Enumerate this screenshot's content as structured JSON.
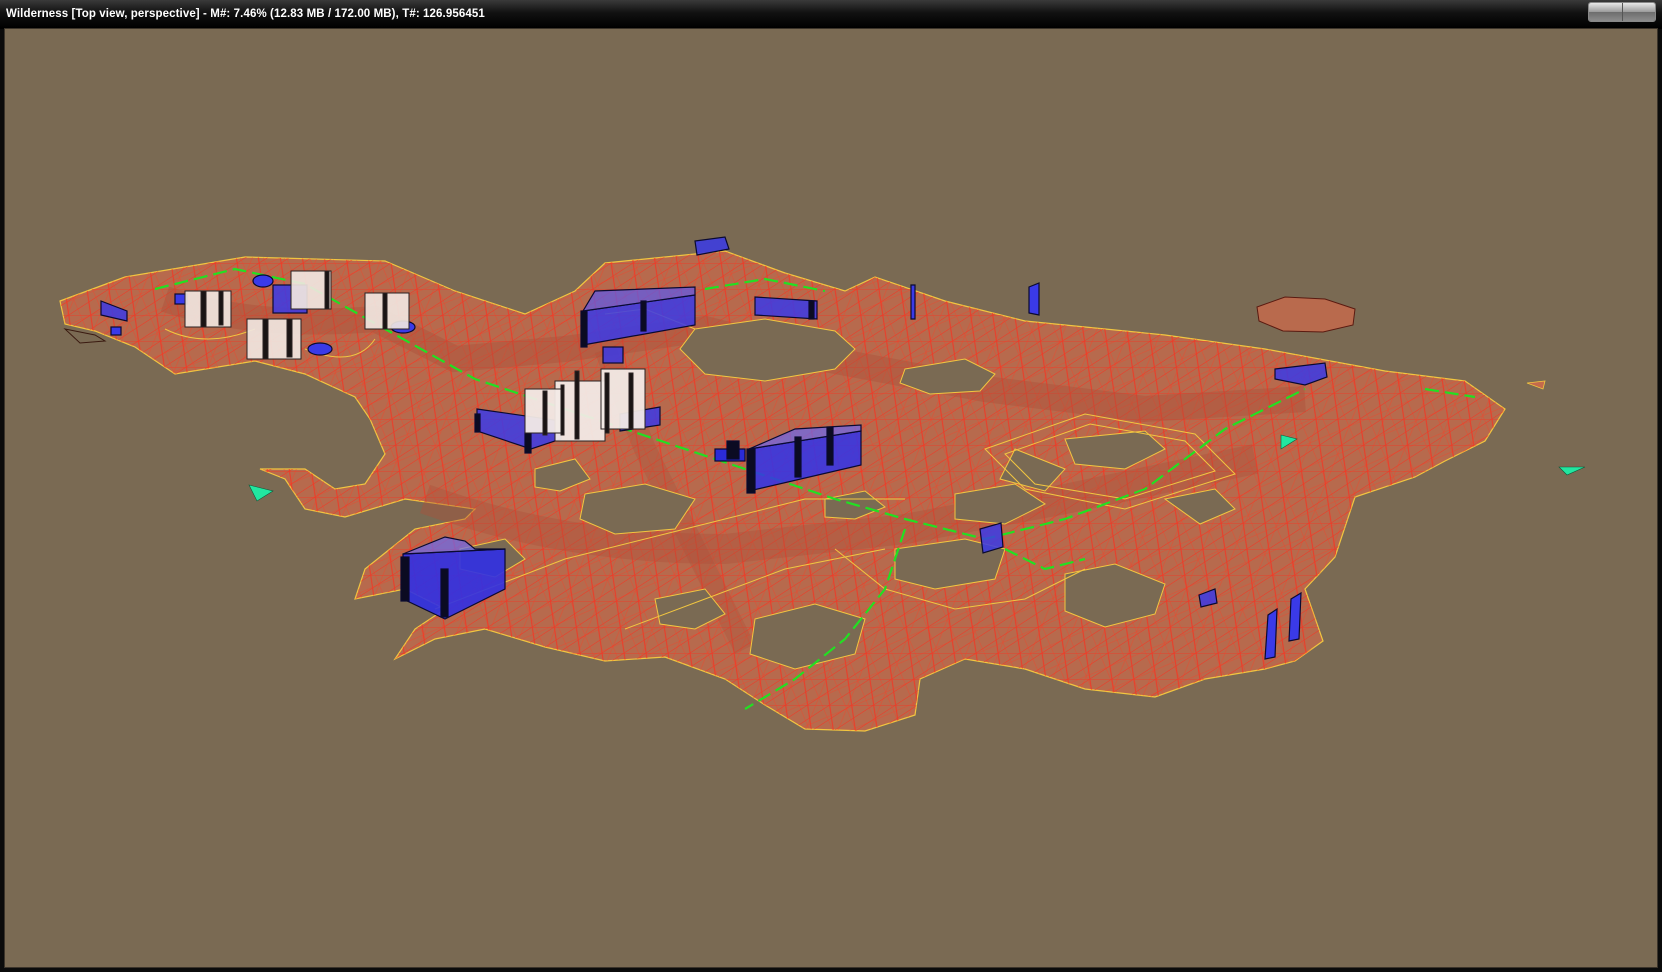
{
  "window": {
    "title": "Wilderness [Top view, perspective] - M#: 7.46% (12.83 MB / 172.00 MB), T#: 126.956451",
    "caption_buttons": [
      "minimize-button",
      "close-button"
    ]
  },
  "viewport": {
    "background": "#7a6a53",
    "navmesh_fill": "#c26a4c",
    "navmesh_edge": "#ff2a1a",
    "border_edge": "#f2c640",
    "path_color": "#22e022",
    "obstacle_blue": "#2a2ae6",
    "obstacle_white": "#ece2dc",
    "marker_color": "#22e6a0"
  }
}
